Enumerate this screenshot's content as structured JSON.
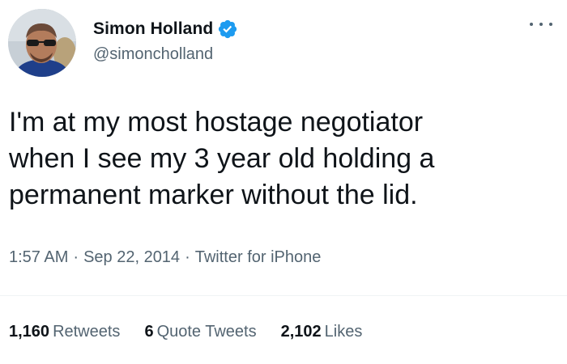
{
  "author": {
    "display_name": "Simon Holland",
    "handle": "@simoncholland",
    "verified_icon": "verified-badge-icon",
    "verified_color": "#1d9bf0"
  },
  "menu": {
    "icon": "more-options-icon"
  },
  "tweet": {
    "lines": [
      "I'm at my most hostage negotiator",
      "when I see my 3 year old holding a",
      "permanent marker without the lid."
    ]
  },
  "meta": {
    "time": "1:57 AM",
    "separator": "·",
    "date": "Sep 22, 2014",
    "source": "Twitter for iPhone"
  },
  "stats": {
    "retweets": {
      "count": "1,160",
      "label": "Retweets"
    },
    "quote_tweets": {
      "count": "6",
      "label": "Quote Tweets"
    },
    "likes": {
      "count": "2,102",
      "label": "Likes"
    }
  }
}
